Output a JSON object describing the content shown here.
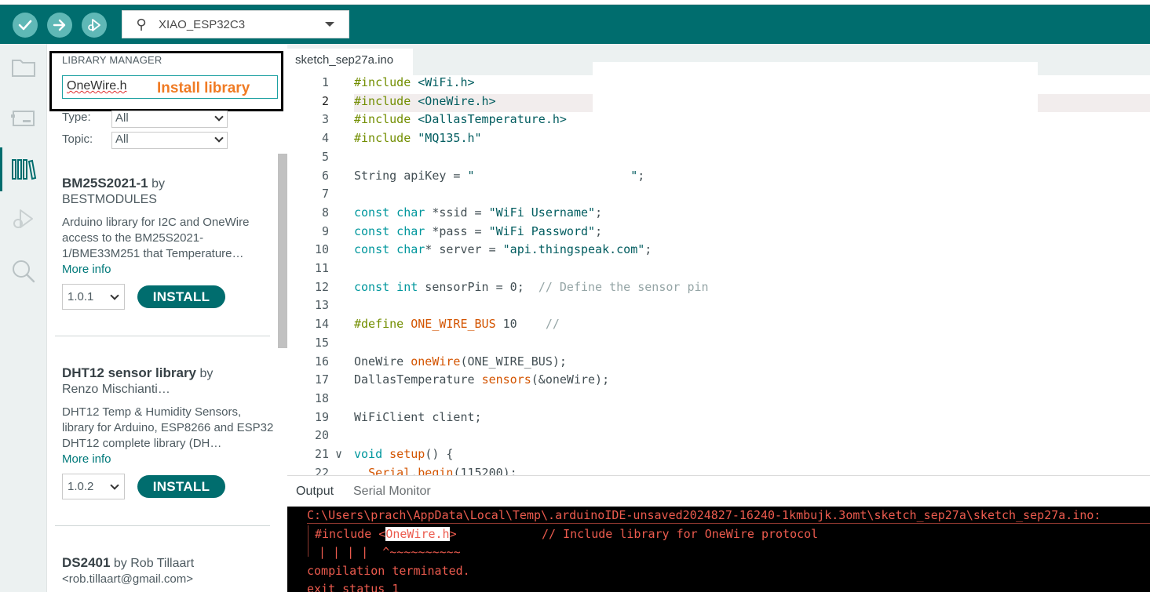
{
  "toolbar": {
    "verify_icon": "checkmark-icon",
    "upload_icon": "arrow-right-icon",
    "debug_icon": "debug-icon",
    "board_icon": "usb-icon",
    "board_name": "XIAO_ESP32C3"
  },
  "sidebar": {
    "items": [
      "folder-icon",
      "board-manager-icon",
      "library-icon",
      "debug-icon",
      "search-icon"
    ],
    "active": "library-icon"
  },
  "library_manager": {
    "title": "LIBRARY MANAGER",
    "search_value": "OneWire.h",
    "annotation": "Install library",
    "type_label": "Type:",
    "type_value": "All",
    "topic_label": "Topic:",
    "topic_value": "All",
    "items": [
      {
        "name": "BM25S2021-1",
        "by": "by",
        "author": "BESTMODULES",
        "description": "Arduino library for I2C and OneWire access to the BM25S2021-1/BME33M251 that Temperature…",
        "more_info": "More info",
        "version": "1.0.1",
        "install_label": "INSTALL"
      },
      {
        "name": "DHT12 sensor library",
        "by": "by",
        "author": "Renzo Mischianti…",
        "description": "DHT12 Temp & Humidity Sensors, library for Arduino, ESP8266 and ESP32 DHT12 complete library (DH…",
        "more_info": "More info",
        "version": "1.0.2",
        "install_label": "INSTALL"
      },
      {
        "name": "DS2401",
        "by": "by Rob Tillaart",
        "author": "<rob.tillaart@gmail.com>"
      }
    ]
  },
  "editor": {
    "tab_name": "sketch_sep27a.ino",
    "active_line": 2,
    "lines": [
      {
        "n": "1",
        "parts": [
          [
            "pp",
            "#include "
          ],
          [
            "str",
            "<WiFi.h>"
          ]
        ]
      },
      {
        "n": "2",
        "parts": [
          [
            "pp",
            "#include "
          ],
          [
            "str",
            "<OneWire.h>"
          ]
        ]
      },
      {
        "n": "3",
        "parts": [
          [
            "pp",
            "#include "
          ],
          [
            "str",
            "<DallasTemperature.h>"
          ]
        ]
      },
      {
        "n": "4",
        "parts": [
          [
            "pp",
            "#include "
          ],
          [
            "str",
            "\"MQ135.h\""
          ]
        ]
      },
      {
        "n": "5",
        "parts": []
      },
      {
        "n": "6",
        "parts": [
          [
            "",
            "String apiKey = "
          ],
          [
            "str",
            "\"                      \""
          ],
          [
            "",
            ";"
          ]
        ]
      },
      {
        "n": "7",
        "parts": []
      },
      {
        "n": "8",
        "parts": [
          [
            "kw",
            "const char"
          ],
          [
            "",
            " *ssid = "
          ],
          [
            "str",
            "\"WiFi Username\""
          ],
          [
            "",
            ";"
          ]
        ]
      },
      {
        "n": "9",
        "parts": [
          [
            "kw",
            "const char"
          ],
          [
            "",
            " *pass = "
          ],
          [
            "str",
            "\"WiFi Password\""
          ],
          [
            "",
            ";"
          ]
        ]
      },
      {
        "n": "10",
        "parts": [
          [
            "kw",
            "const char"
          ],
          [
            "",
            "* server = "
          ],
          [
            "str",
            "\"api.thingspeak.com\""
          ],
          [
            "",
            ";"
          ]
        ]
      },
      {
        "n": "11",
        "parts": []
      },
      {
        "n": "12",
        "parts": [
          [
            "kw",
            "const int"
          ],
          [
            "",
            " sensorPin = 0;  "
          ],
          [
            "cm",
            "// Define the sensor pin"
          ]
        ]
      },
      {
        "n": "13",
        "parts": []
      },
      {
        "n": "14",
        "parts": [
          [
            "pp",
            "#define "
          ],
          [
            "fn",
            "ONE_WIRE_BUS"
          ],
          [
            "",
            " 10    "
          ],
          [
            "cm",
            "// "
          ]
        ]
      },
      {
        "n": "15",
        "parts": []
      },
      {
        "n": "16",
        "parts": [
          [
            "",
            "OneWire "
          ],
          [
            "fn",
            "oneWire"
          ],
          [
            "",
            "(ONE_WIRE_BUS);"
          ]
        ]
      },
      {
        "n": "17",
        "parts": [
          [
            "",
            "DallasTemperature "
          ],
          [
            "fn",
            "sensors"
          ],
          [
            "",
            "(&oneWire);"
          ]
        ]
      },
      {
        "n": "18",
        "parts": []
      },
      {
        "n": "19",
        "parts": [
          [
            "",
            "WiFiClient client;"
          ]
        ]
      },
      {
        "n": "20",
        "parts": []
      },
      {
        "n": "21",
        "parts": [
          [
            "kw",
            "void"
          ],
          [
            "",
            " "
          ],
          [
            "fn",
            "setup"
          ],
          [
            "",
            "() {"
          ]
        ],
        "fold": "∨"
      },
      {
        "n": "22",
        "parts": [
          [
            "",
            "  "
          ],
          [
            "fn",
            "Serial"
          ],
          [
            "",
            "."
          ],
          [
            "fn",
            "begin"
          ],
          [
            "",
            "(115200);"
          ]
        ]
      }
    ]
  },
  "output": {
    "tabs": [
      "Output",
      "Serial Monitor"
    ],
    "lines": [
      "C:\\Users\\prach\\AppData\\Local\\Temp\\.arduinoIDE-unsaved2024827-16240-1kmbujk.3omt\\sketch_sep27a\\sketch_sep27a.ino:",
      "compilation terminated.",
      "exit status 1"
    ],
    "include_prefix": "#include <",
    "include_highlight": "OneWire.h",
    "include_suffix": ">            // Include library for OneWire protocol",
    "pipes": "| | | |",
    "carets": "^~~~~~~~~~~"
  }
}
